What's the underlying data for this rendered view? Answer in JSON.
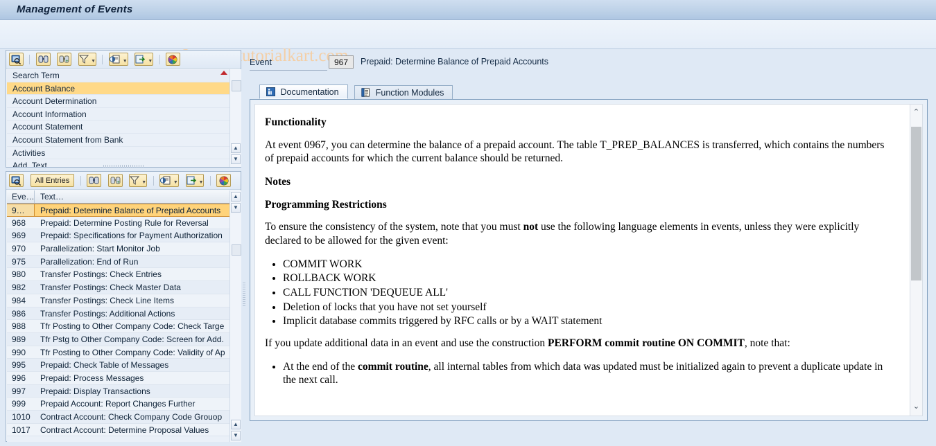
{
  "window": {
    "title": "Management of Events",
    "watermark": "© www.tutorialkart.com"
  },
  "toolbar_icons": {
    "command_field_icon": "sap-session-icon",
    "find": "binoculars-find-icon",
    "find_next": "binoculars-find-next-icon",
    "filter": "filter-icon",
    "print_preview": "print-preview-icon",
    "export": "export-local-file-icon",
    "color": "color-palette-icon",
    "search": "magnifier-search-icon"
  },
  "search_panel": {
    "toolbar": {
      "search_label": "",
      "find_label": "",
      "filter_label": ""
    },
    "rows": [
      {
        "label": "Search Term",
        "selected": false,
        "header": true
      },
      {
        "label": "Account Balance",
        "selected": true,
        "header": false
      },
      {
        "label": "Account Determination",
        "selected": false,
        "header": false
      },
      {
        "label": "Account Information",
        "selected": false,
        "header": false
      },
      {
        "label": "Account Statement",
        "selected": false,
        "header": false
      },
      {
        "label": "Account Statement from Bank",
        "selected": false,
        "header": false
      },
      {
        "label": "Activities",
        "selected": false,
        "header": false
      },
      {
        "label": "Add. Text",
        "selected": false,
        "header": false
      }
    ]
  },
  "events_panel": {
    "toolbar": {
      "all_entries_label": "All Entries"
    },
    "columns": [
      "Eve…",
      "Text…"
    ],
    "rows": [
      {
        "id": "9…",
        "text": "Prepaid: Determine Balance of Prepaid Accounts",
        "selected": true
      },
      {
        "id": "968",
        "text": "Prepaid: Determine Posting Rule for Reversal",
        "selected": false
      },
      {
        "id": "969",
        "text": "Prepaid: Specifications for Payment Authorization",
        "selected": false
      },
      {
        "id": "970",
        "text": "Parallelization: Start Monitor Job",
        "selected": false
      },
      {
        "id": "975",
        "text": "Parallelization: End of Run",
        "selected": false
      },
      {
        "id": "980",
        "text": "Transfer Postings: Check Entries",
        "selected": false
      },
      {
        "id": "982",
        "text": "Transfer Postings: Check Master Data",
        "selected": false
      },
      {
        "id": "984",
        "text": "Transfer Postings: Check Line Items",
        "selected": false
      },
      {
        "id": "986",
        "text": "Transfer Postings: Additional Actions",
        "selected": false
      },
      {
        "id": "988",
        "text": "Tfr Posting to Other Company Code: Check Targe",
        "selected": false
      },
      {
        "id": "989",
        "text": "Tfr Pstg to Other Company Code: Screen for Add.",
        "selected": false
      },
      {
        "id": "990",
        "text": "Tfr Posting to Other Company Code: Validity of Ap",
        "selected": false
      },
      {
        "id": "995",
        "text": "Prepaid: Check Table of Messages",
        "selected": false
      },
      {
        "id": "996",
        "text": "Prepaid: Process Messages",
        "selected": false
      },
      {
        "id": "997",
        "text": "Prepaid: Display Transactions",
        "selected": false
      },
      {
        "id": "999",
        "text": "Prepaid Account: Report Changes Further",
        "selected": false
      },
      {
        "id": "1010",
        "text": "Contract Account: Check Company Code Grouop",
        "selected": false
      },
      {
        "id": "1017",
        "text": "Contract Account: Determine Proposal Values",
        "selected": false
      }
    ]
  },
  "detail": {
    "event_label": "Event",
    "event_number": "967",
    "event_text": "Prepaid: Determine Balance of Prepaid Accounts",
    "tabs": [
      {
        "label": "Documentation",
        "icon": "documentation-icon",
        "active": true
      },
      {
        "label": "Function Modules",
        "icon": "function-modules-icon",
        "active": false
      }
    ],
    "documentation": {
      "heading_functionality": "Functionality",
      "para_functionality_1": "At event 0967, you can determine the balance of a prepaid account. The table ",
      "para_functionality_table": "T_PREP_BALANCES",
      "para_functionality_2": " is transferred, which contains the numbers of prepaid accounts for which the current balance should be returned.",
      "heading_notes": "Notes",
      "heading_restrictions": "Programming Restrictions",
      "para_restrictions_1": "To ensure the consistency of the system, note that you must ",
      "para_restrictions_not": "not",
      "para_restrictions_2": " use the following language elements in events, unless they were explicitly declared to be allowed for the given event:",
      "bullets": [
        "COMMIT WORK",
        "ROLLBACK WORK",
        "CALL FUNCTION 'DEQUEUE ALL'",
        "Deletion of locks that you have not set yourself",
        "Implicit database commits triggered by RFC calls or by a WAIT statement"
      ],
      "para_update_1": "If you update additional data in an event and use the construction ",
      "para_update_bold": "PERFORM commit routine ON COMMIT",
      "para_update_2": ", note that:",
      "bullet2_1": "At the end of the ",
      "bullet2_bold": "commit routine",
      "bullet2_2": ", all internal tables from which data was updated must be initialized again to prevent a duplicate update in the next call."
    }
  },
  "colors": {
    "title_bar": "#bed2e8",
    "selection_yellow": "#ffd37a",
    "search_selection": "#ffd988",
    "watermark": "#f4cfa6",
    "panel_border": "#9fb4cc",
    "background": "#dfe9f5"
  }
}
